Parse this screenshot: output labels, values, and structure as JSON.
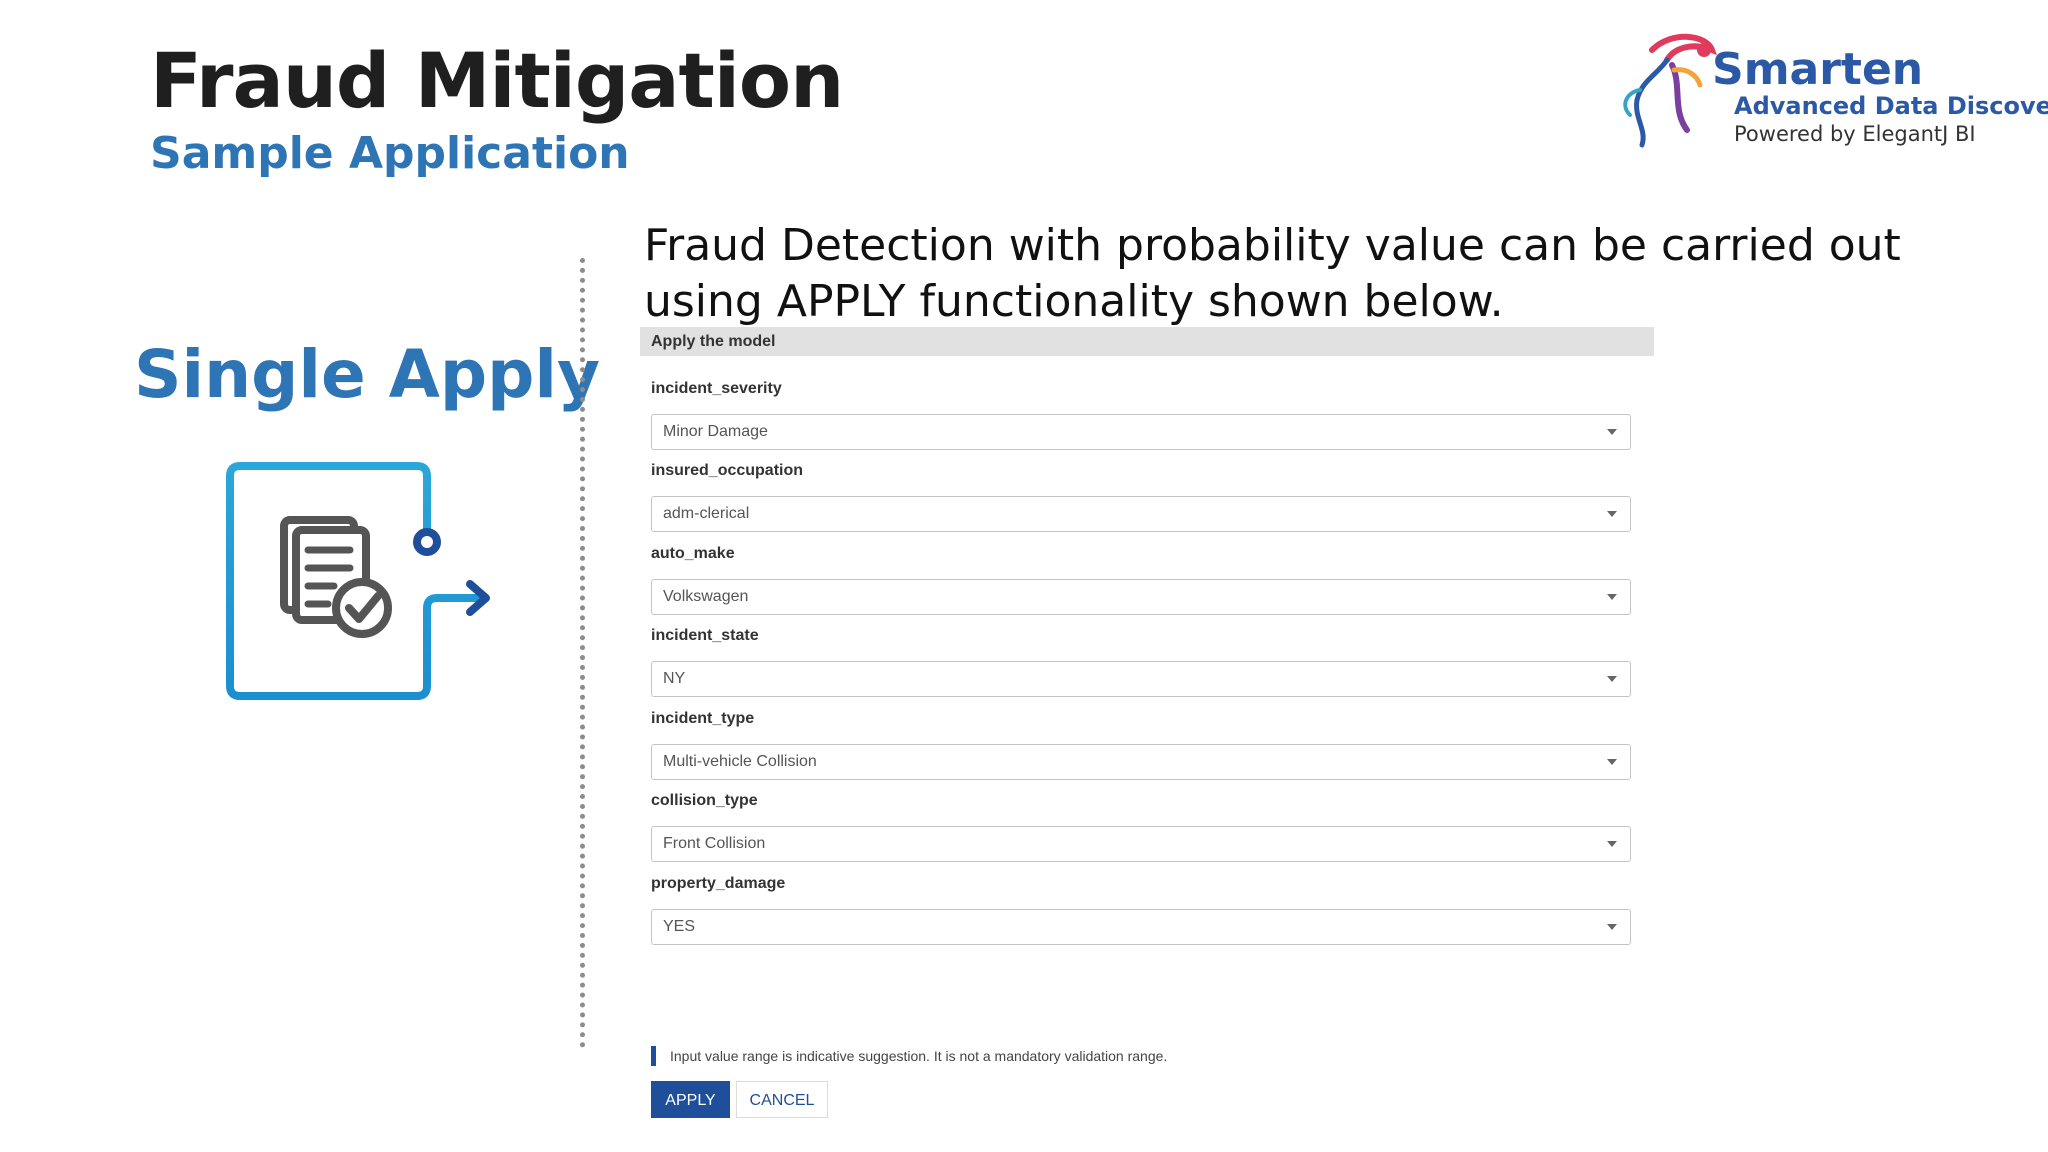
{
  "slide": {
    "title": "Fraud Mitigation",
    "subtitle": "Sample Application",
    "section_label": "Single Apply",
    "intro_line1": "Fraud Detection with probability value can be carried out",
    "intro_line2": "using APPLY functionality shown below."
  },
  "logo": {
    "name": "Smarten",
    "tagline": "Advanced Data Discovery",
    "powered_by": "Powered by ElegantJ BI"
  },
  "panel": {
    "header": "Apply the model",
    "fields": [
      {
        "label": "incident_severity",
        "value": "Minor Damage"
      },
      {
        "label": "insured_occupation",
        "value": "adm-clerical"
      },
      {
        "label": "auto_make",
        "value": "Volkswagen"
      },
      {
        "label": "incident_state",
        "value": "NY"
      },
      {
        "label": "incident_type",
        "value": "Multi-vehicle Collision"
      },
      {
        "label": "collision_type",
        "value": "Front Collision"
      },
      {
        "label": "property_damage",
        "value": "YES"
      }
    ],
    "note": "Input value range is indicative suggestion. It is not a mandatory validation range.",
    "apply_label": "APPLY",
    "cancel_label": "CANCEL"
  },
  "colors": {
    "title_blue": "#2e75b6",
    "button_blue": "#1f4e9a",
    "header_gray": "#e1e1e1"
  },
  "icons": [
    "smarten-logo-icon",
    "document-check-icon",
    "arrow-right-icon"
  ]
}
